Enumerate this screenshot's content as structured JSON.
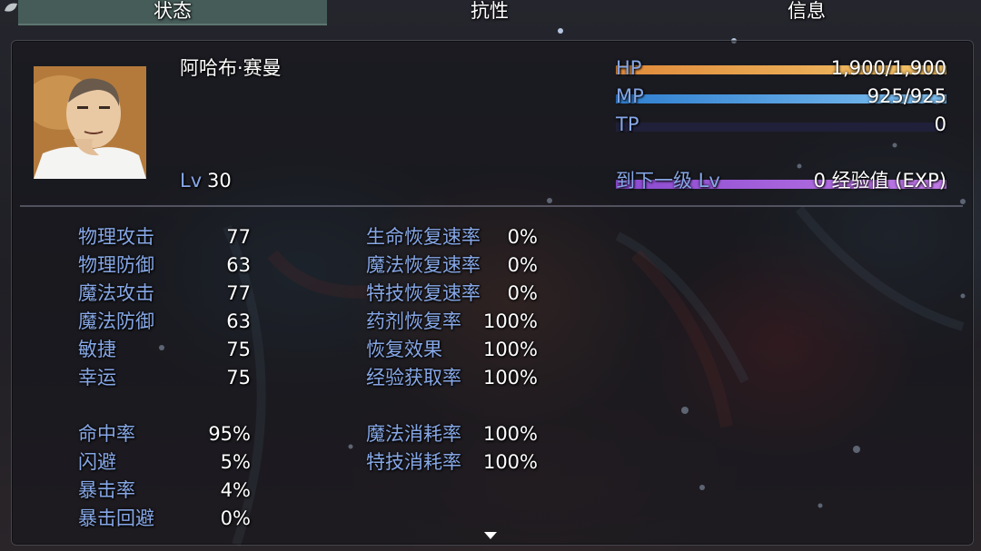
{
  "tabs": [
    {
      "label": "状态"
    },
    {
      "label": "抗性"
    },
    {
      "label": "信息"
    }
  ],
  "actor": {
    "name": "阿哈布·赛曼",
    "level_label": "Lv",
    "level": "30"
  },
  "gauges": {
    "hp": {
      "label": "HP",
      "value_text": "1,900/1,900",
      "fill": 1.0,
      "color_start": "#e08a3a",
      "color_end": "#f2c46a"
    },
    "mp": {
      "label": "MP",
      "value_text": "925/925",
      "fill": 1.0,
      "color_start": "#2f7fd0",
      "color_end": "#7fc0f0"
    },
    "tp": {
      "label": "TP",
      "value_text": "0",
      "fill": 0.0,
      "color_start": "#2f9f4a",
      "color_end": "#8ad05a"
    },
    "exp": {
      "label": "到下一级 Lv",
      "value_text": "0 经验值 (EXP)",
      "fill": 1.0,
      "color_start": "#8a4ad0",
      "color_end": "#c07ae6"
    }
  },
  "params": [
    {
      "label": "物理攻击",
      "value": "77"
    },
    {
      "label": "物理防御",
      "value": "63"
    },
    {
      "label": "魔法攻击",
      "value": "77"
    },
    {
      "label": "魔法防御",
      "value": "63"
    },
    {
      "label": "敏捷",
      "value": "75"
    },
    {
      "label": "幸运",
      "value": "75"
    }
  ],
  "sparams": [
    {
      "label": "生命恢复速率",
      "value": "0%"
    },
    {
      "label": "魔法恢复速率",
      "value": "0%"
    },
    {
      "label": "特技恢复速率",
      "value": "0%"
    },
    {
      "label": "药剂恢复率",
      "value": "100%"
    },
    {
      "label": "恢复效果",
      "value": "100%"
    },
    {
      "label": "经验获取率",
      "value": "100%"
    }
  ],
  "xparams": [
    {
      "label": "命中率",
      "value": "95%"
    },
    {
      "label": "闪避",
      "value": "5%"
    },
    {
      "label": "暴击率",
      "value": "4%"
    },
    {
      "label": "暴击回避",
      "value": "0%"
    }
  ],
  "costs": [
    {
      "label": "魔法消耗率",
      "value": "100%"
    },
    {
      "label": "特技消耗率",
      "value": "100%"
    }
  ],
  "icons": {
    "corner": "gear-leaf-icon",
    "more": "scroll-down-arrow-icon"
  },
  "colors": {
    "system_text": "#86a7e6",
    "active_tab": "#465c58"
  }
}
